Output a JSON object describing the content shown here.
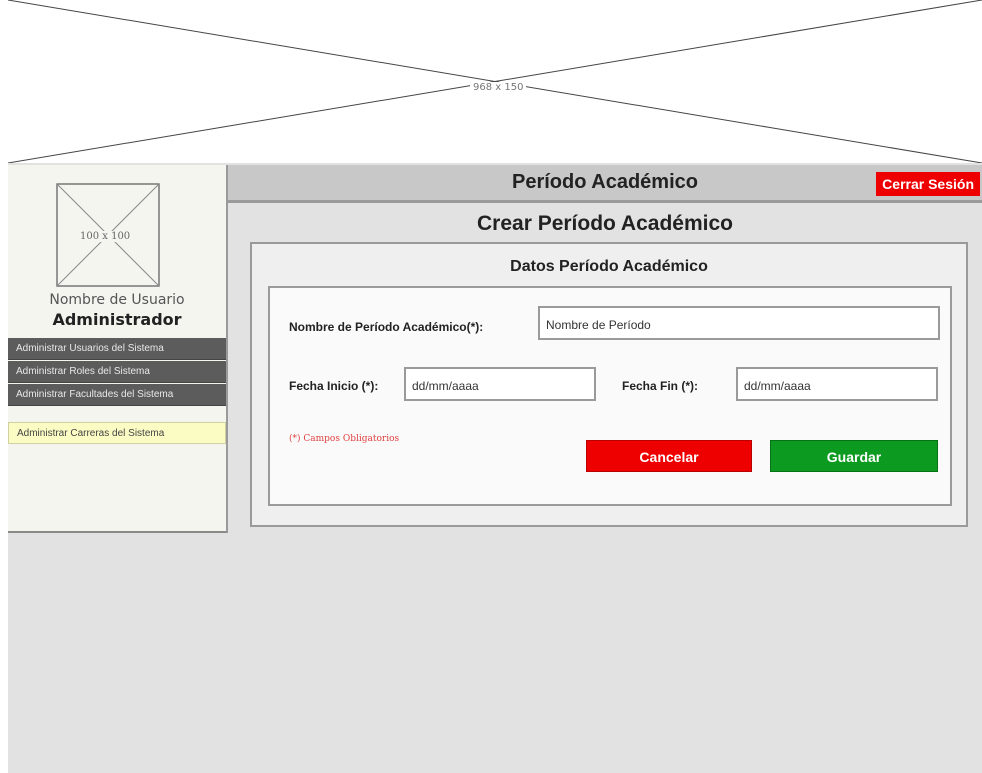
{
  "banner": {
    "placeholder_label": "968 x 150"
  },
  "sidebar": {
    "avatar_label": "100 x 100",
    "user_name": "Nombre de Usuario",
    "user_role": "Administrador",
    "items": [
      {
        "label": "Administrar Usuarios del Sistema",
        "active": false
      },
      {
        "label": "Administrar Roles del Sistema",
        "active": false
      },
      {
        "label": "Administrar Facultades del Sistema",
        "active": false
      },
      {
        "label": "Administrar Carreras del Sistema",
        "active": true
      }
    ]
  },
  "header": {
    "title": "Período Académico",
    "logout_label": "Cerrar Sesión"
  },
  "main": {
    "page_title": "Crear Período Académico",
    "panel_title": "Datos Período Académico",
    "form": {
      "name_label": "Nombre de Período Académico(*):",
      "name_value": "Nombre de Período",
      "start_label": "Fecha Inicio (*):",
      "start_value": "dd/mm/aaaa",
      "end_label": "Fecha Fin (*):",
      "end_value": "dd/mm/aaaa",
      "required_note": "(*) Campos Obligatorios",
      "cancel_label": "Cancelar",
      "save_label": "Guardar"
    }
  },
  "colors": {
    "danger": "#ee0000",
    "success": "#0c9a20",
    "nav_dark": "#5c5c5c",
    "nav_active": "#fbfbc4",
    "background": "#e2e2e2"
  }
}
